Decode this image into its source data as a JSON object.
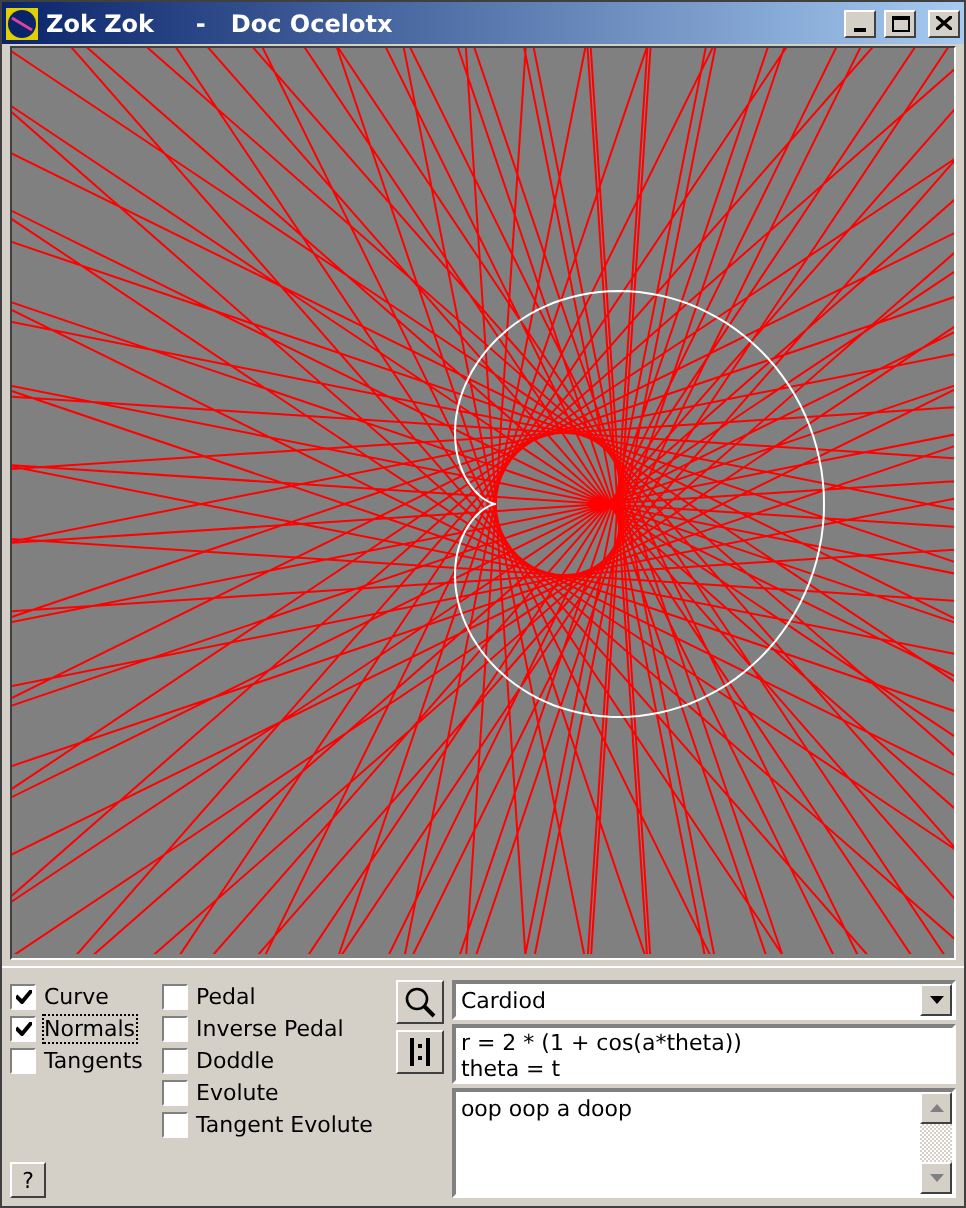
{
  "window": {
    "title": "Zok Zok",
    "document": "Doc Ocelotx",
    "separator": "-"
  },
  "options_left": [
    {
      "label": "Curve",
      "checked": true,
      "focused": false
    },
    {
      "label": "Normals",
      "checked": true,
      "focused": true
    },
    {
      "label": "Tangents",
      "checked": false,
      "focused": false
    }
  ],
  "options_right": [
    {
      "label": "Pedal",
      "checked": false
    },
    {
      "label": "Inverse Pedal",
      "checked": false
    },
    {
      "label": "Doddle",
      "checked": false
    },
    {
      "label": "Evolute",
      "checked": false
    },
    {
      "label": "Tangent Evolute",
      "checked": false
    }
  ],
  "help_button": "?",
  "curve_select": "Cardiod",
  "equations": [
    "r = 2 * (1 + cos(a*theta))",
    "theta = t"
  ],
  "notes": "oop oop a doop"
}
